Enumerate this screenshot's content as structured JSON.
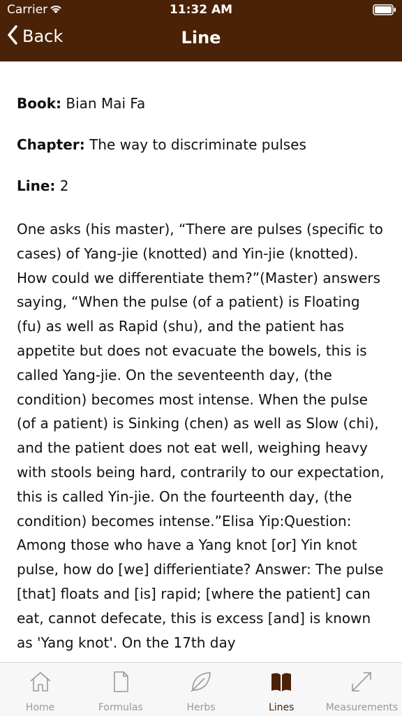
{
  "status": {
    "carrier": "Carrier",
    "time": "11:32 AM"
  },
  "nav": {
    "back_label": "Back",
    "title": "Line"
  },
  "content": {
    "fields": [
      {
        "label": "Book:",
        "value": "Bian Mai Fa"
      },
      {
        "label": "Chapter:",
        "value": "The way to discriminate pulses"
      },
      {
        "label": "Line:",
        "value": "2"
      }
    ],
    "body": "One asks (his master), “There are pulses (specific to cases) of Yang-jie (knotted) and Yin-jie (knotted). How could we differentiate them?”(Master) answers saying, “When the pulse (of a patient) is Floating (fu) as well as Rapid (shu), and the patient has appetite but does not evacuate the bowels, this is called Yang-jie. On the seventeenth day, (the condition) becomes most intense. When the pulse (of a patient) is Sinking (chen) as well as Slow (chi), and the patient does not eat well, weighing heavy with stools being hard, contrarily to our expectation, this is called Yin-jie. On the fourteenth day, (the condition) becomes intense.”Elisa Yip:Question: Among those who have a Yang knot [or] Yin knot pulse, how do [we] differientiate? Answer: The pulse [that] floats and [is] rapid; [where the patient] can eat, cannot defecate, this is excess [and] is known as 'Yang knot'. On the 17th day"
  },
  "tabs": [
    {
      "label": "Home",
      "icon": "home-icon",
      "active": false
    },
    {
      "label": "Formulas",
      "icon": "document-icon",
      "active": false
    },
    {
      "label": "Herbs",
      "icon": "leaf-icon",
      "active": false
    },
    {
      "label": "Lines",
      "icon": "book-icon",
      "active": true
    },
    {
      "label": "Measurements",
      "icon": "ruler-icon",
      "active": false
    }
  ],
  "colors": {
    "accent": "#4a2207",
    "tab_inactive": "#999999",
    "tabbar_bg": "#f7f7f7"
  }
}
